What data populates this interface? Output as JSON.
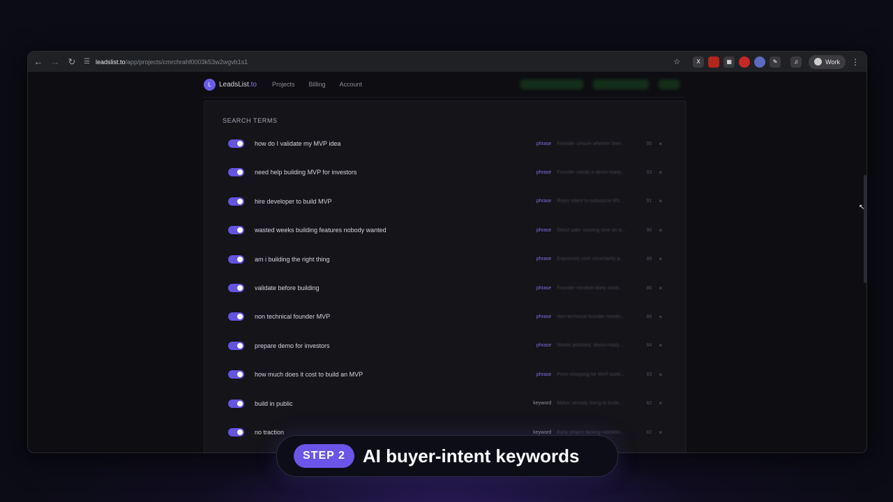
{
  "browser": {
    "url_host": "leadslist.to",
    "url_path": "/app/projects/cmrchrahf0003k53w2wgvb1s1",
    "profile_label": "Work"
  },
  "app": {
    "logo_letter": "L",
    "brand_name": "LeadsList",
    "brand_tld": ".to",
    "nav": [
      "Projects",
      "Billing",
      "Account"
    ]
  },
  "panel": {
    "title": "SEARCH TERMS",
    "rows": [
      {
        "term": "how do I validate my MVP idea",
        "type": "phrase",
        "desc": "Founder unsure whether their...",
        "score": "95"
      },
      {
        "term": "need help building MVP for investors",
        "type": "phrase",
        "desc": "Founder needs a demo-ready...",
        "score": "93"
      },
      {
        "term": "hire developer to build MVP",
        "type": "phrase",
        "desc": "Buyer intent to outsource MV...",
        "score": "91"
      },
      {
        "term": "wasted weeks building features nobody wanted",
        "type": "phrase",
        "desc": "Direct pain: wasting time on w...",
        "score": "90"
      },
      {
        "term": "am i building the right thing",
        "type": "phrase",
        "desc": "Expresses core uncertainty p...",
        "score": "88"
      },
      {
        "term": "validate before building",
        "type": "phrase",
        "desc": "Founder mindset-likely need...",
        "score": "86"
      },
      {
        "term": "non technical founder MVP",
        "type": "phrase",
        "desc": "Non-technical founder needin...",
        "score": "86"
      },
      {
        "term": "prepare demo for investors",
        "type": "phrase",
        "desc": "Needs polished, demo-ready...",
        "score": "84"
      },
      {
        "term": "how much does it cost to build an MVP",
        "type": "phrase",
        "desc": "Price-shopping for MVP build...",
        "score": "83"
      },
      {
        "term": "build in public",
        "type": "keyword",
        "desc": "Maker already doing to build...",
        "score": "82"
      },
      {
        "term": "no traction",
        "type": "keyword",
        "desc": "Early project lacking validatio...",
        "score": "82"
      }
    ]
  },
  "caption": {
    "step_label": "STEP 2",
    "text": "AI buyer-intent keywords"
  },
  "colors": {
    "accent": "#6a55e8",
    "toggle_on": "#6454e0",
    "background": "#0b0c14"
  }
}
